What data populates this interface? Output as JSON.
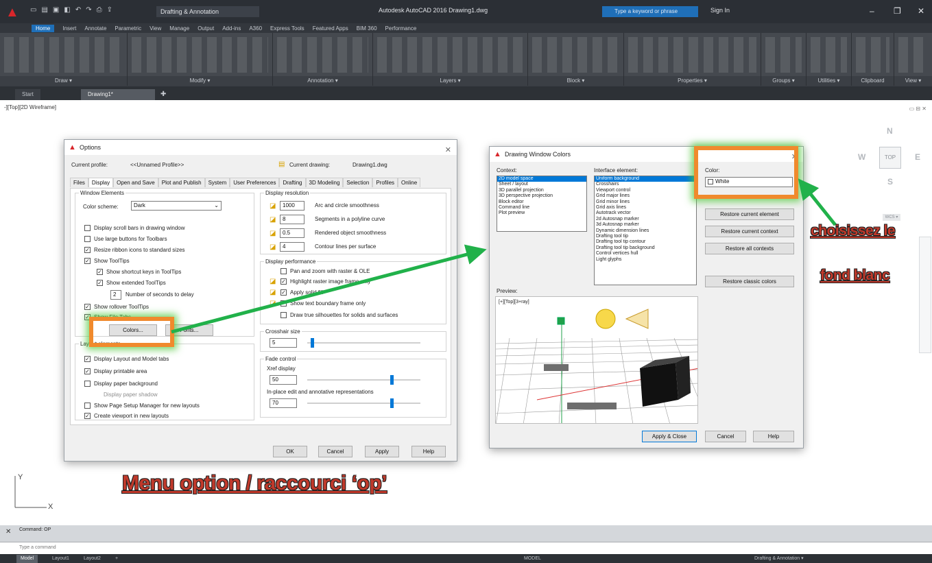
{
  "app": {
    "title": "Autodesk AutoCAD 2016   Drawing1.dwg",
    "workspace": "Drafting & Annotation",
    "search_placeholder": "Type a keyword or phrase",
    "signin": "Sign In",
    "min": "–",
    "max": "❐",
    "close": "✕"
  },
  "ribbon": {
    "tabs": [
      "Home",
      "Insert",
      "Annotate",
      "Parametric",
      "View",
      "Manage",
      "Output",
      "Add-ins",
      "A360",
      "Express Tools",
      "Featured Apps",
      "BIM 360",
      "Performance"
    ],
    "panels": [
      "Draw ▾",
      "Modify ▾",
      "Annotation ▾",
      "Layers ▾",
      "Block ▾",
      "Properties ▾",
      "Groups ▾",
      "Utilities ▾",
      "Clipboard",
      "View ▾"
    ]
  },
  "doc_tabs": [
    "Start",
    "Drawing1*"
  ],
  "viewport": {
    "label": "-][Top][2D Wireframe]",
    "controls": "▭ ⊟ ✕"
  },
  "viewcube": {
    "n": "N",
    "s": "S",
    "e": "E",
    "w": "W",
    "top": "TOP",
    "wcs": "WCS ▾"
  },
  "ucs": {
    "x": "X",
    "y": "Y"
  },
  "options_dialog": {
    "title": "Options",
    "current_profile_label": "Current profile:",
    "current_profile_value": "<<Unnamed Profile>>",
    "current_drawing_label": "Current drawing:",
    "current_drawing_value": "Drawing1.dwg",
    "tabs": [
      "Files",
      "Display",
      "Open and Save",
      "Plot and Publish",
      "System",
      "User Preferences",
      "Drafting",
      "3D Modeling",
      "Selection",
      "Profiles",
      "Online"
    ],
    "window_elements_title": "Window Elements",
    "color_scheme_label": "Color scheme:",
    "color_scheme_value": "Dark",
    "window_checks": [
      "Display scroll bars in drawing window",
      "Use large buttons for Toolbars",
      "Resize ribbon icons to standard sizes",
      "Show ToolTips",
      "Show shortcut keys in ToolTips",
      "Show extended ToolTips",
      "Number of seconds to delay",
      "Show rollover ToolTips",
      "Show File Tabs"
    ],
    "delay_value": "2",
    "colors_button": "Colors...",
    "fonts_button": "Fonts...",
    "layout_title": "Layout elements",
    "layout_checks": [
      "Display Layout and Model tabs",
      "Display printable area",
      "Display paper background",
      "Display paper shadow",
      "Show Page Setup Manager for new layouts",
      "Create viewport in new layouts"
    ],
    "resolution_title": "Display resolution",
    "resolution_rows": [
      {
        "value": "1000",
        "label": "Arc and circle smoothness"
      },
      {
        "value": "8",
        "label": "Segments in a polyline curve"
      },
      {
        "value": "0.5",
        "label": "Rendered object smoothness"
      },
      {
        "value": "4",
        "label": "Contour lines per surface"
      }
    ],
    "performance_title": "Display performance",
    "performance_checks": [
      "Pan and zoom with raster & OLE",
      "Highlight raster image frame only",
      "Apply solid fill",
      "Show text boundary frame only",
      "Draw true silhouettes for solids and surfaces"
    ],
    "crosshair_title": "Crosshair size",
    "crosshair_value": "5",
    "fade_title": "Fade control",
    "xref_label": "Xref display",
    "xref_value": "50",
    "inplace_label": "In-place edit and annotative representations",
    "inplace_value": "70",
    "ok": "OK",
    "cancel": "Cancel",
    "apply": "Apply",
    "help": "Help"
  },
  "colors_dialog": {
    "title": "Drawing Window Colors",
    "context_label": "Context:",
    "contexts": [
      "2D model space",
      "Sheet / layout",
      "3D parallel projection",
      "3D perspective projection",
      "Block editor",
      "Command line",
      "Plot preview"
    ],
    "element_label": "Interface element:",
    "elements": [
      "Uniform background",
      "Crosshairs",
      "Viewport control",
      "Grid major lines",
      "Grid minor lines",
      "Grid axis lines",
      "Autotrack vector",
      "2d Autosnap marker",
      "3d Autosnap marker",
      "Dynamic dimension lines",
      "Drafting tool tip",
      "Drafting tool tip contour",
      "Drafting tool tip background",
      "Control vertices hull",
      "Light glyphs"
    ],
    "color_label": "Color:",
    "color_value": "White",
    "restore_element": "Restore current element",
    "restore_context": "Restore current context",
    "restore_all": "Restore all contexts",
    "restore_classic": "Restore classic colors",
    "preview_label": "Preview:",
    "preview_viewport": "[+][Top][3+ray]",
    "apply_close": "Apply & Close",
    "cancel": "Cancel",
    "help": "Help"
  },
  "annotations": {
    "menu_option": "Menu option / raccourci ‘op’",
    "choose_line1": "choisissez le",
    "choose_line2": "fond blanc"
  },
  "command": {
    "history": "Command: OP",
    "placeholder": "Type a command"
  },
  "status": {
    "tabs": [
      "Model",
      "Layout1",
      "Layout2",
      "+"
    ],
    "model_label": "MODEL",
    "workspace": "Drafting & Annotation ▾"
  },
  "colors": {
    "accent": "#0078d7",
    "autocad_red": "#d8262b",
    "annot_red": "#c0392b",
    "highlight_orange": "#f08a2d",
    "arrow_green": "#21b14a"
  }
}
